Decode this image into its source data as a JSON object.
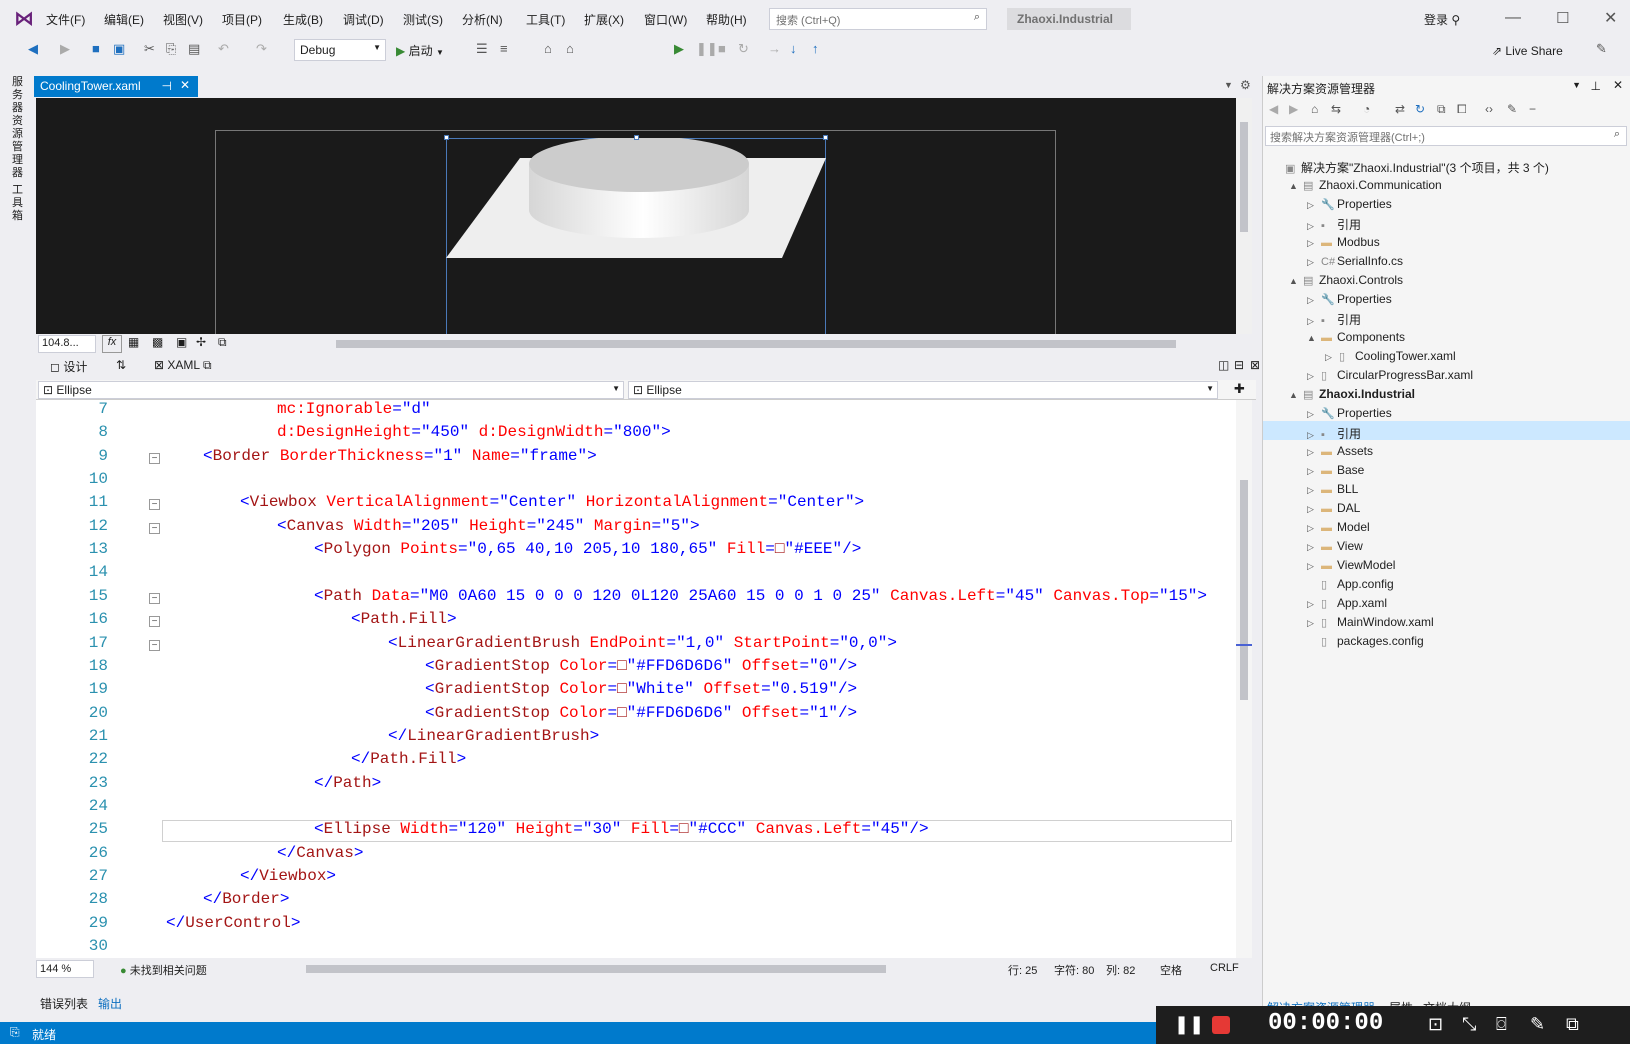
{
  "menu": [
    "文件(F)",
    "编辑(E)",
    "视图(V)",
    "项目(P)",
    "生成(B)",
    "调试(D)",
    "测试(S)",
    "分析(N)",
    "工具(T)",
    "扩展(X)",
    "窗口(W)",
    "帮助(H)"
  ],
  "search": {
    "placeholder": "搜索 (Ctrl+Q)"
  },
  "solution_name": "Zhaoxi.Industrial",
  "login": "登录",
  "live_share": "Live Share",
  "toolbar": {
    "config": "Debug",
    "start": "启动"
  },
  "left_tabs": [
    "服务器资源管理器",
    "工具箱"
  ],
  "doc_tab": "CoolingTower.xaml",
  "design": {
    "zoom": "104.8...",
    "fx": "fx"
  },
  "split": {
    "design": "设计",
    "swap": "⇅",
    "xaml": "XAML"
  },
  "selectors": {
    "left": "Ellipse",
    "right": "Ellipse"
  },
  "code_lines": [
    {
      "n": "7",
      "html": "<span class='a'>mc:Ignorable</span><span class='b'>=</span><span class='v'>\"d\"</span>",
      "indent": 3,
      "fold": ""
    },
    {
      "n": "8",
      "html": "<span class='a'>d:DesignHeight</span><span class='b'>=</span><span class='v'>\"450\"</span> <span class='a'>d:DesignWidth</span><span class='b'>=</span><span class='v'>\"800\"</span><span class='b'>&gt;</span>",
      "indent": 3,
      "fold": ""
    },
    {
      "n": "9",
      "html": "<span class='b'>&lt;</span>Border <span class='a'>BorderThickness</span><span class='b'>=</span><span class='v'>\"1\"</span> <span class='a'>Name</span><span class='b'>=</span><span class='v'>\"frame\"</span><span class='b'>&gt;</span>",
      "indent": 1,
      "fold": "−"
    },
    {
      "n": "10",
      "html": "",
      "indent": 0,
      "fold": ""
    },
    {
      "n": "11",
      "html": "<span class='b'>&lt;</span>Viewbox <span class='a'>VerticalAlignment</span><span class='b'>=</span><span class='v'>\"Center\"</span> <span class='a'>HorizontalAlignment</span><span class='b'>=</span><span class='v'>\"Center\"</span><span class='b'>&gt;</span>",
      "indent": 2,
      "fold": "−"
    },
    {
      "n": "12",
      "html": "<span class='b'>&lt;</span>Canvas <span class='a'>Width</span><span class='b'>=</span><span class='v'>\"205\"</span> <span class='a'>Height</span><span class='b'>=</span><span class='v'>\"245\"</span> <span class='a'>Margin</span><span class='b'>=</span><span class='v'>\"5\"</span><span class='b'>&gt;</span>",
      "indent": 3,
      "fold": "−"
    },
    {
      "n": "13",
      "html": "<span class='b'>&lt;</span>Polygon <span class='a'>Points</span><span class='b'>=</span><span class='v'>\"0,65 40,10 205,10 180,65\"</span> <span class='a'>Fill</span><span class='b'>=</span>□<span class='v'>\"#EEE\"</span><span class='b'>/&gt;</span>",
      "indent": 4,
      "fold": ""
    },
    {
      "n": "14",
      "html": "",
      "indent": 0,
      "fold": ""
    },
    {
      "n": "15",
      "html": "<span class='b'>&lt;</span>Path <span class='a'>Data</span><span class='b'>=</span><span class='v'>\"M0 0A60 15 0 0 0 120 0L120 25A60 15 0 0 1 0 25\"</span> <span class='a'>Canvas.Left</span><span class='b'>=</span><span class='v'>\"45\"</span> <span class='a'>Canvas.Top</span><span class='b'>=</span><span class='v'>\"15\"</span><span class='b'>&gt;</span>",
      "indent": 4,
      "fold": "−"
    },
    {
      "n": "16",
      "html": "<span class='b'>&lt;</span>Path.Fill<span class='b'>&gt;</span>",
      "indent": 5,
      "fold": "−"
    },
    {
      "n": "17",
      "html": "<span class='b'>&lt;</span>LinearGradientBrush <span class='a'>EndPoint</span><span class='b'>=</span><span class='v'>\"1,0\"</span> <span class='a'>StartPoint</span><span class='b'>=</span><span class='v'>\"0,0\"</span><span class='b'>&gt;</span>",
      "indent": 6,
      "fold": "−"
    },
    {
      "n": "18",
      "html": "<span class='b'>&lt;</span>GradientStop <span class='a'>Color</span><span class='b'>=</span>□<span class='v'>\"#FFD6D6D6\"</span> <span class='a'>Offset</span><span class='b'>=</span><span class='v'>\"0\"</span><span class='b'>/&gt;</span>",
      "indent": 7,
      "fold": ""
    },
    {
      "n": "19",
      "html": "<span class='b'>&lt;</span>GradientStop <span class='a'>Color</span><span class='b'>=</span>□<span class='v'>\"White\"</span> <span class='a'>Offset</span><span class='b'>=</span><span class='v'>\"0.519\"</span><span class='b'>/&gt;</span>",
      "indent": 7,
      "fold": ""
    },
    {
      "n": "20",
      "html": "<span class='b'>&lt;</span>GradientStop <span class='a'>Color</span><span class='b'>=</span>□<span class='v'>\"#FFD6D6D6\"</span> <span class='a'>Offset</span><span class='b'>=</span><span class='v'>\"1\"</span><span class='b'>/&gt;</span>",
      "indent": 7,
      "fold": ""
    },
    {
      "n": "21",
      "html": "<span class='b'>&lt;/</span>LinearGradientBrush<span class='b'>&gt;</span>",
      "indent": 6,
      "fold": ""
    },
    {
      "n": "22",
      "html": "<span class='b'>&lt;/</span>Path.Fill<span class='b'>&gt;</span>",
      "indent": 5,
      "fold": ""
    },
    {
      "n": "23",
      "html": "<span class='b'>&lt;/</span>Path<span class='b'>&gt;</span>",
      "indent": 4,
      "fold": ""
    },
    {
      "n": "24",
      "html": "",
      "indent": 0,
      "fold": ""
    },
    {
      "n": "25",
      "html": "<span class='b'>&lt;</span>Ellipse <span class='a'>Width</span><span class='b'>=</span><span class='v'>\"120\"</span> <span class='a'>Height</span><span class='b'>=</span><span class='v'>\"30\"</span> <span class='a'>Fill</span><span class='b'>=</span>□<span class='v'>\"#CCC\"</span> <span class='a'>Canvas.Left</span><span class='b'>=</span><span class='v'>\"45\"</span><span class='b'>/&gt;</span>",
      "indent": 4,
      "fold": ""
    },
    {
      "n": "26",
      "html": "<span class='b'>&lt;/</span>Canvas<span class='b'>&gt;</span>",
      "indent": 3,
      "fold": ""
    },
    {
      "n": "27",
      "html": "<span class='b'>&lt;/</span>Viewbox<span class='b'>&gt;</span>",
      "indent": 2,
      "fold": ""
    },
    {
      "n": "28",
      "html": "<span class='b'>&lt;/</span>Border<span class='b'>&gt;</span>",
      "indent": 1,
      "fold": ""
    },
    {
      "n": "29",
      "html": "<span class='b'>&lt;/</span>UserControl<span class='b'>&gt;</span>",
      "indent": 0,
      "fold": ""
    },
    {
      "n": "30",
      "html": "",
      "indent": 0,
      "fold": ""
    }
  ],
  "status_row": {
    "zoom": "144 %",
    "issues": "未找到相关问题",
    "line": "行: 25",
    "char": "字符: 80",
    "col": "列: 82",
    "space": "空格",
    "crlf": "CRLF"
  },
  "bottom_tabs": [
    "错误列表",
    "输出"
  ],
  "statusbar": {
    "ready": "就绪"
  },
  "solution_explorer": {
    "title": "解决方案资源管理器",
    "search_placeholder": "搜索解决方案资源管理器(Ctrl+;)",
    "items": [
      {
        "label": "解决方案\"Zhaoxi.Industrial\"(3 个项目，共 3 个)",
        "level": 0,
        "exp": "",
        "icon": "solution-icon"
      },
      {
        "label": "Zhaoxi.Communication",
        "level": 1,
        "exp": "▲",
        "icon": "csproj-icon"
      },
      {
        "label": "Properties",
        "level": 2,
        "exp": "▷",
        "icon": "wrench-icon"
      },
      {
        "label": "引用",
        "level": 2,
        "exp": "▷",
        "icon": "reference-icon"
      },
      {
        "label": "Modbus",
        "level": 2,
        "exp": "▷",
        "icon": "folder-icon"
      },
      {
        "label": "SerialInfo.cs",
        "level": 2,
        "exp": "▷",
        "icon": "cs-file-icon"
      },
      {
        "label": "Zhaoxi.Controls",
        "level": 1,
        "exp": "▲",
        "icon": "csproj-icon"
      },
      {
        "label": "Properties",
        "level": 2,
        "exp": "▷",
        "icon": "wrench-icon"
      },
      {
        "label": "引用",
        "level": 2,
        "exp": "▷",
        "icon": "reference-icon"
      },
      {
        "label": "Components",
        "level": 2,
        "exp": "▲",
        "icon": "folder-icon"
      },
      {
        "label": "CoolingTower.xaml",
        "level": 3,
        "exp": "▷",
        "icon": "xaml-file-icon"
      },
      {
        "label": "CircularProgressBar.xaml",
        "level": 2,
        "exp": "▷",
        "icon": "xaml-file-icon"
      },
      {
        "label": "Zhaoxi.Industrial",
        "level": 1,
        "exp": "▲",
        "icon": "csproj-icon",
        "bold": true
      },
      {
        "label": "Properties",
        "level": 2,
        "exp": "▷",
        "icon": "wrench-icon"
      },
      {
        "label": "引用",
        "level": 2,
        "exp": "▷",
        "icon": "reference-icon"
      },
      {
        "label": "Assets",
        "level": 2,
        "exp": "▷",
        "icon": "folder-icon"
      },
      {
        "label": "Base",
        "level": 2,
        "exp": "▷",
        "icon": "folder-icon"
      },
      {
        "label": "BLL",
        "level": 2,
        "exp": "▷",
        "icon": "folder-icon"
      },
      {
        "label": "DAL",
        "level": 2,
        "exp": "▷",
        "icon": "folder-icon"
      },
      {
        "label": "Model",
        "level": 2,
        "exp": "▷",
        "icon": "folder-icon"
      },
      {
        "label": "View",
        "level": 2,
        "exp": "▷",
        "icon": "folder-icon"
      },
      {
        "label": "ViewModel",
        "level": 2,
        "exp": "▷",
        "icon": "folder-icon"
      },
      {
        "label": "App.config",
        "level": 2,
        "exp": "",
        "icon": "config-file-icon"
      },
      {
        "label": "App.xaml",
        "level": 2,
        "exp": "▷",
        "icon": "xaml-file-icon"
      },
      {
        "label": "MainWindow.xaml",
        "level": 2,
        "exp": "▷",
        "icon": "xaml-file-icon"
      },
      {
        "label": "packages.config",
        "level": 2,
        "exp": "",
        "icon": "config-file-icon"
      }
    ],
    "bottom_tabs": [
      "解决方案资源管理器",
      "属性",
      "文档大纲"
    ]
  },
  "recorder": {
    "time": "00:00:00"
  }
}
